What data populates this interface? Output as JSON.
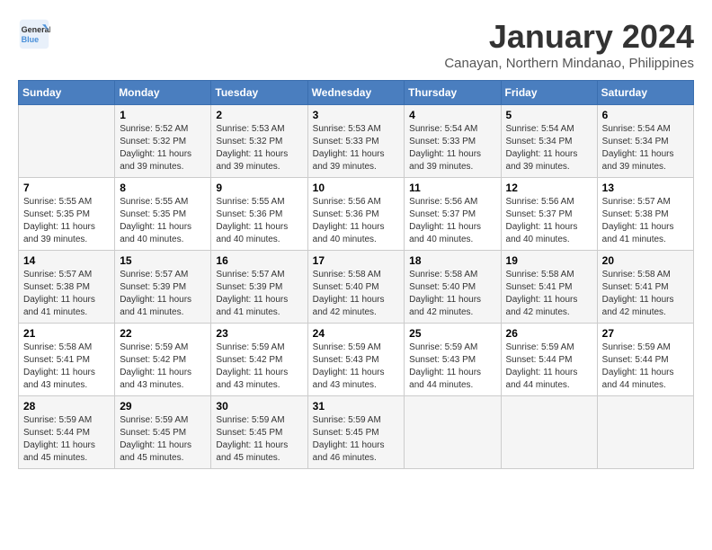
{
  "logo": {
    "line1": "General",
    "line2": "Blue"
  },
  "title": "January 2024",
  "location": "Canayan, Northern Mindanao, Philippines",
  "weekdays": [
    "Sunday",
    "Monday",
    "Tuesday",
    "Wednesday",
    "Thursday",
    "Friday",
    "Saturday"
  ],
  "weeks": [
    [
      {
        "day": "",
        "info": ""
      },
      {
        "day": "1",
        "info": "Sunrise: 5:52 AM\nSunset: 5:32 PM\nDaylight: 11 hours\nand 39 minutes."
      },
      {
        "day": "2",
        "info": "Sunrise: 5:53 AM\nSunset: 5:32 PM\nDaylight: 11 hours\nand 39 minutes."
      },
      {
        "day": "3",
        "info": "Sunrise: 5:53 AM\nSunset: 5:33 PM\nDaylight: 11 hours\nand 39 minutes."
      },
      {
        "day": "4",
        "info": "Sunrise: 5:54 AM\nSunset: 5:33 PM\nDaylight: 11 hours\nand 39 minutes."
      },
      {
        "day": "5",
        "info": "Sunrise: 5:54 AM\nSunset: 5:34 PM\nDaylight: 11 hours\nand 39 minutes."
      },
      {
        "day": "6",
        "info": "Sunrise: 5:54 AM\nSunset: 5:34 PM\nDaylight: 11 hours\nand 39 minutes."
      }
    ],
    [
      {
        "day": "7",
        "info": "Sunrise: 5:55 AM\nSunset: 5:35 PM\nDaylight: 11 hours\nand 39 minutes."
      },
      {
        "day": "8",
        "info": "Sunrise: 5:55 AM\nSunset: 5:35 PM\nDaylight: 11 hours\nand 40 minutes."
      },
      {
        "day": "9",
        "info": "Sunrise: 5:55 AM\nSunset: 5:36 PM\nDaylight: 11 hours\nand 40 minutes."
      },
      {
        "day": "10",
        "info": "Sunrise: 5:56 AM\nSunset: 5:36 PM\nDaylight: 11 hours\nand 40 minutes."
      },
      {
        "day": "11",
        "info": "Sunrise: 5:56 AM\nSunset: 5:37 PM\nDaylight: 11 hours\nand 40 minutes."
      },
      {
        "day": "12",
        "info": "Sunrise: 5:56 AM\nSunset: 5:37 PM\nDaylight: 11 hours\nand 40 minutes."
      },
      {
        "day": "13",
        "info": "Sunrise: 5:57 AM\nSunset: 5:38 PM\nDaylight: 11 hours\nand 41 minutes."
      }
    ],
    [
      {
        "day": "14",
        "info": "Sunrise: 5:57 AM\nSunset: 5:38 PM\nDaylight: 11 hours\nand 41 minutes."
      },
      {
        "day": "15",
        "info": "Sunrise: 5:57 AM\nSunset: 5:39 PM\nDaylight: 11 hours\nand 41 minutes."
      },
      {
        "day": "16",
        "info": "Sunrise: 5:57 AM\nSunset: 5:39 PM\nDaylight: 11 hours\nand 41 minutes."
      },
      {
        "day": "17",
        "info": "Sunrise: 5:58 AM\nSunset: 5:40 PM\nDaylight: 11 hours\nand 42 minutes."
      },
      {
        "day": "18",
        "info": "Sunrise: 5:58 AM\nSunset: 5:40 PM\nDaylight: 11 hours\nand 42 minutes."
      },
      {
        "day": "19",
        "info": "Sunrise: 5:58 AM\nSunset: 5:41 PM\nDaylight: 11 hours\nand 42 minutes."
      },
      {
        "day": "20",
        "info": "Sunrise: 5:58 AM\nSunset: 5:41 PM\nDaylight: 11 hours\nand 42 minutes."
      }
    ],
    [
      {
        "day": "21",
        "info": "Sunrise: 5:58 AM\nSunset: 5:41 PM\nDaylight: 11 hours\nand 43 minutes."
      },
      {
        "day": "22",
        "info": "Sunrise: 5:59 AM\nSunset: 5:42 PM\nDaylight: 11 hours\nand 43 minutes."
      },
      {
        "day": "23",
        "info": "Sunrise: 5:59 AM\nSunset: 5:42 PM\nDaylight: 11 hours\nand 43 minutes."
      },
      {
        "day": "24",
        "info": "Sunrise: 5:59 AM\nSunset: 5:43 PM\nDaylight: 11 hours\nand 43 minutes."
      },
      {
        "day": "25",
        "info": "Sunrise: 5:59 AM\nSunset: 5:43 PM\nDaylight: 11 hours\nand 44 minutes."
      },
      {
        "day": "26",
        "info": "Sunrise: 5:59 AM\nSunset: 5:44 PM\nDaylight: 11 hours\nand 44 minutes."
      },
      {
        "day": "27",
        "info": "Sunrise: 5:59 AM\nSunset: 5:44 PM\nDaylight: 11 hours\nand 44 minutes."
      }
    ],
    [
      {
        "day": "28",
        "info": "Sunrise: 5:59 AM\nSunset: 5:44 PM\nDaylight: 11 hours\nand 45 minutes."
      },
      {
        "day": "29",
        "info": "Sunrise: 5:59 AM\nSunset: 5:45 PM\nDaylight: 11 hours\nand 45 minutes."
      },
      {
        "day": "30",
        "info": "Sunrise: 5:59 AM\nSunset: 5:45 PM\nDaylight: 11 hours\nand 45 minutes."
      },
      {
        "day": "31",
        "info": "Sunrise: 5:59 AM\nSunset: 5:45 PM\nDaylight: 11 hours\nand 46 minutes."
      },
      {
        "day": "",
        "info": ""
      },
      {
        "day": "",
        "info": ""
      },
      {
        "day": "",
        "info": ""
      }
    ]
  ]
}
